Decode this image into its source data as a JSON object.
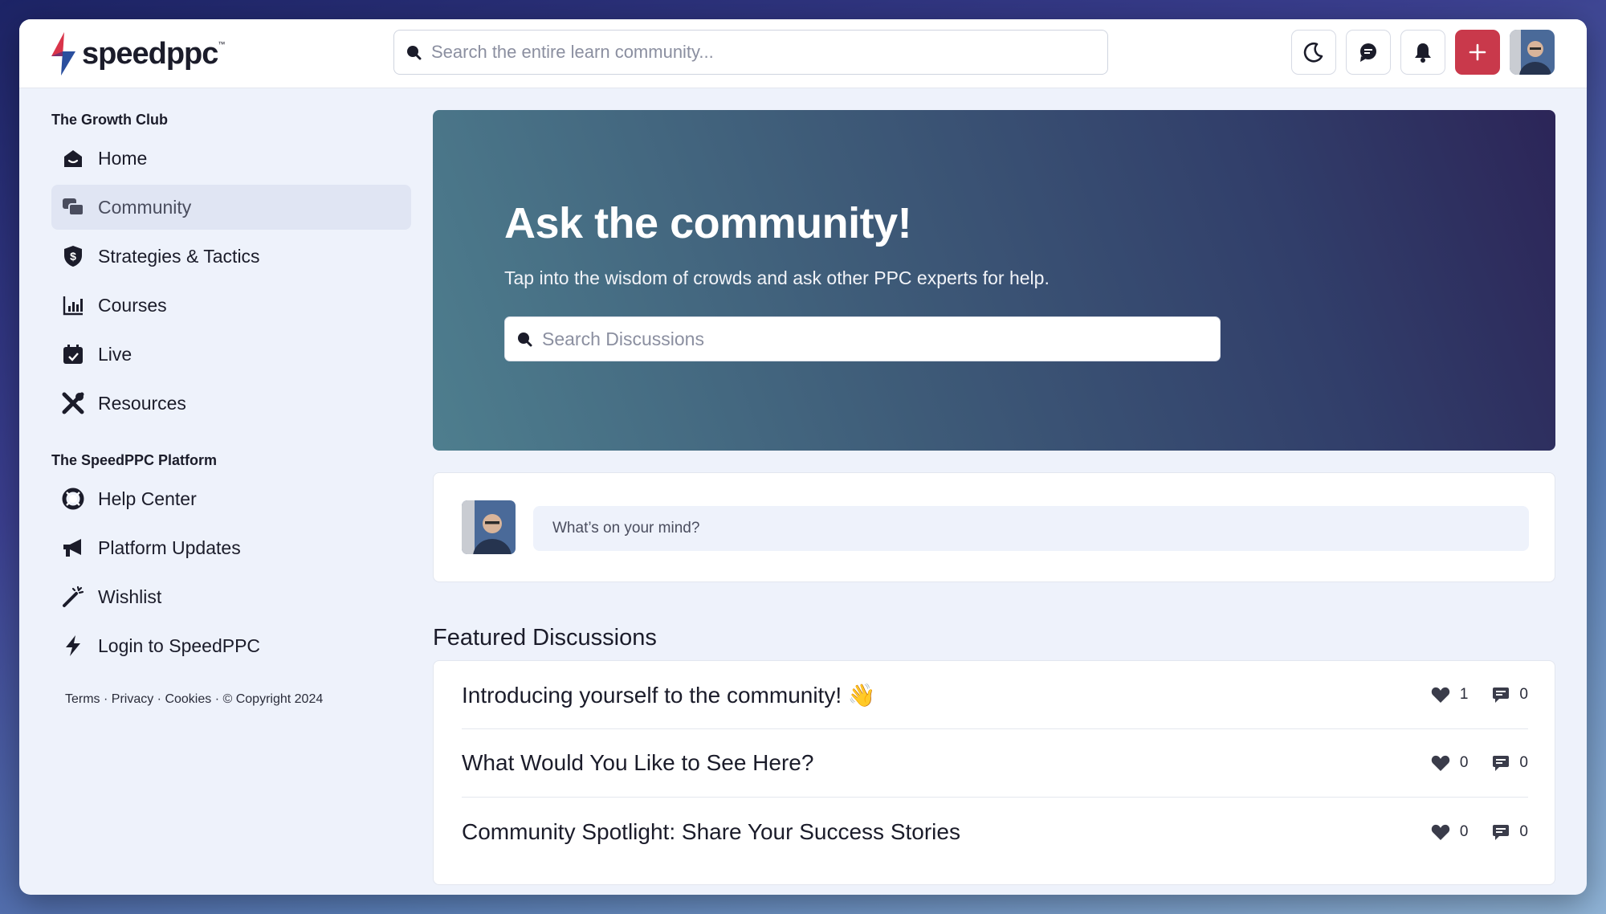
{
  "brand": {
    "name": "speedppc",
    "tm": "™",
    "accent": "#c9394b"
  },
  "top_search": {
    "placeholder": "Search the entire learn community..."
  },
  "top_actions": [
    "moon-icon",
    "chat-icon",
    "bell-icon",
    "plus-icon",
    "user-avatar"
  ],
  "sidebar": {
    "section1": "The Growth Club",
    "items1": [
      {
        "label": "Home",
        "icon": "home-icon"
      },
      {
        "label": "Community",
        "icon": "chat-bubbles-icon",
        "active": true
      },
      {
        "label": "Strategies & Tactics",
        "icon": "shield-dollar-icon"
      },
      {
        "label": "Courses",
        "icon": "bar-chart-icon"
      },
      {
        "label": "Live",
        "icon": "calendar-icon"
      },
      {
        "label": "Resources",
        "icon": "tools-icon"
      }
    ],
    "section2": "The SpeedPPC Platform",
    "items2": [
      {
        "label": "Help Center",
        "icon": "lifebuoy-icon"
      },
      {
        "label": "Platform Updates",
        "icon": "megaphone-icon"
      },
      {
        "label": "Wishlist",
        "icon": "magic-wand-icon"
      },
      {
        "label": "Login to SpeedPPC",
        "icon": "bolt-icon"
      }
    ],
    "footer": {
      "terms": "Terms",
      "privacy": "Privacy",
      "cookies": "Cookies",
      "copyright": "© Copyright 2024"
    }
  },
  "hero": {
    "title": "Ask the community!",
    "subtitle": "Tap into the wisdom of crowds and ask other PPC experts for help.",
    "search_placeholder": "Search Discussions"
  },
  "composer": {
    "prompt": "What’s on your mind?"
  },
  "featured": {
    "title": "Featured Discussions",
    "items": [
      {
        "title": "Introducing yourself to the community! 👋",
        "likes": "1",
        "comments": "0"
      },
      {
        "title": "What Would You Like to See Here?",
        "likes": "0",
        "comments": "0"
      },
      {
        "title": "Community Spotlight: Share Your Success Stories",
        "likes": "0",
        "comments": "0"
      }
    ]
  }
}
